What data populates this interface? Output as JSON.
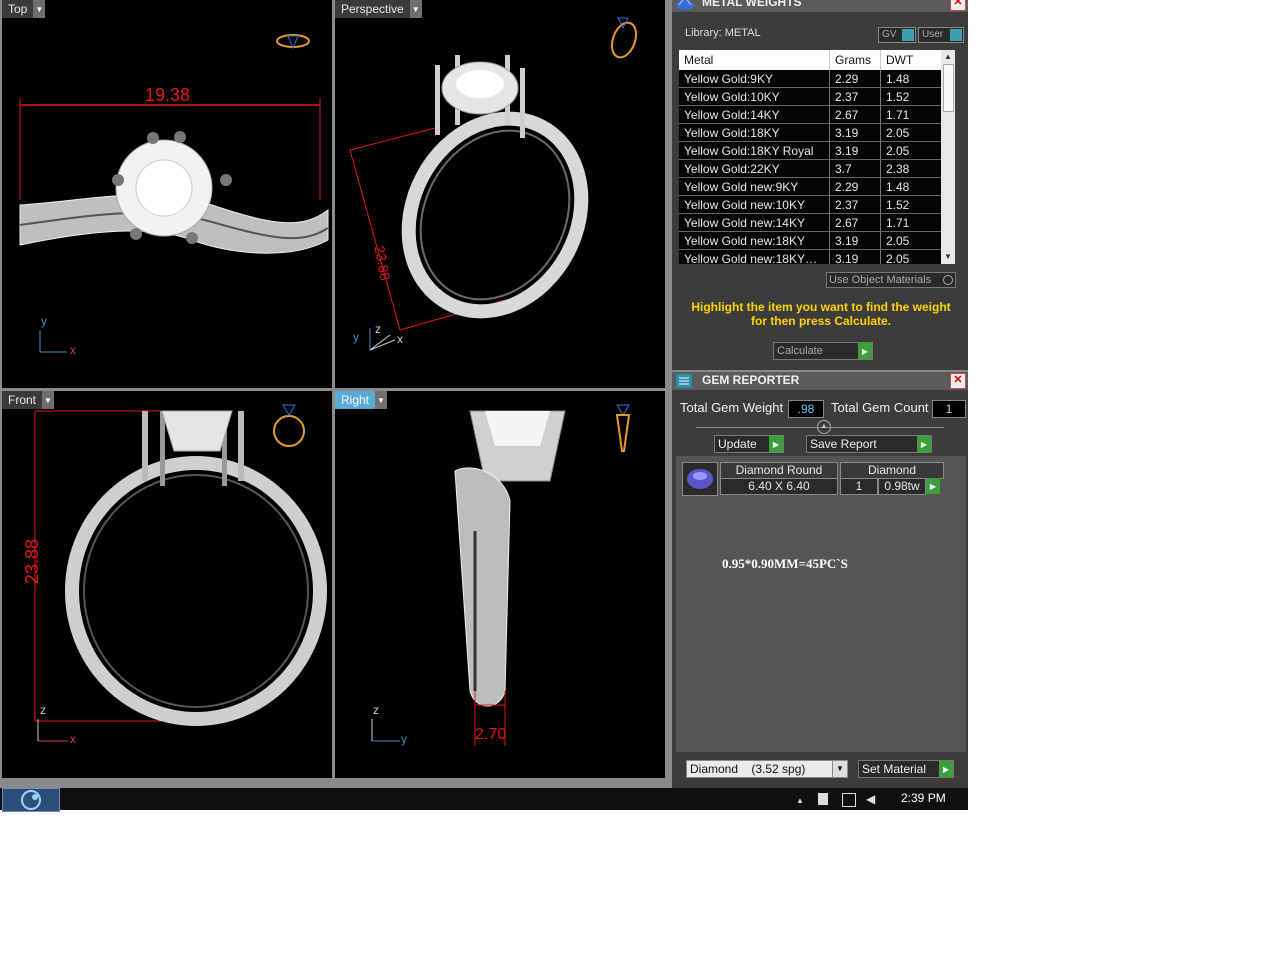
{
  "viewports": {
    "top": {
      "label": "Top",
      "dim": "19.38",
      "ax1": "y",
      "ax2": "x"
    },
    "perspective": {
      "label": "Perspective",
      "dim": "23.88",
      "ax1": "y",
      "ax2": "z",
      "ax3": "x"
    },
    "front": {
      "label": "Front",
      "dim": "23.88",
      "ax1": "z",
      "ax2": "x"
    },
    "right": {
      "label": "Right",
      "dim": "2.70",
      "ax1": "z",
      "ax2": "y"
    }
  },
  "metal": {
    "title": "METAL WEIGHTS",
    "library": "Library: METAL",
    "gv": "GV",
    "user": "User",
    "headers": [
      "Metal",
      "Grams",
      "DWT"
    ],
    "rows": [
      [
        "Yellow Gold:9KY",
        "2.29",
        "1.48"
      ],
      [
        "Yellow Gold:10KY",
        "2.37",
        "1.52"
      ],
      [
        "Yellow Gold:14KY",
        "2.67",
        "1.71"
      ],
      [
        "Yellow Gold:18KY",
        "3.19",
        "2.05"
      ],
      [
        "Yellow Gold:18KY Royal",
        "3.19",
        "2.05"
      ],
      [
        "Yellow Gold:22KY",
        "3.7",
        "2.38"
      ],
      [
        "Yellow Gold new:9KY",
        "2.29",
        "1.48"
      ],
      [
        "Yellow Gold new:10KY",
        "2.37",
        "1.52"
      ],
      [
        "Yellow Gold new:14KY",
        "2.67",
        "1.71"
      ],
      [
        "Yellow Gold new:18KY",
        "3.19",
        "2.05"
      ],
      [
        "Yellow Gold new:18KY…",
        "3.19",
        "2.05"
      ]
    ],
    "use_object_materials": "Use Object Materials",
    "hint": "Highlight the item you want to find the weight for then press Calculate.",
    "calculate": "Calculate"
  },
  "gem": {
    "title": "GEM REPORTER",
    "total_weight_label": "Total Gem Weight",
    "total_weight": ".98",
    "total_count_label": "Total Gem Count",
    "total_count": "1",
    "update": "Update",
    "save_report": "Save Report",
    "item_shape": "Diamond Round",
    "item_material": "Diamond",
    "item_size": "6.40 X 6.40",
    "item_count": "1",
    "item_weight": "0.98tw",
    "note": "0.95*0.90MM=45PC`S",
    "material_select": "Diamond    (3.52 spg)",
    "set_material": "Set Material"
  },
  "taskbar": {
    "time": "2:39 PM"
  },
  "colors": {
    "accent": "#5aa9d6",
    "go": "#3aa13a",
    "dimension": "#e01818",
    "hint": "#ffd400"
  }
}
